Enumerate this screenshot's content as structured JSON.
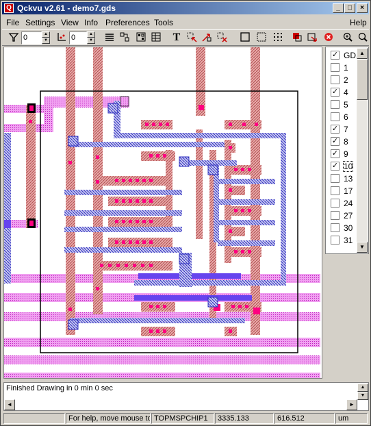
{
  "window": {
    "title": "Qckvu v2.61 - demo7.gds",
    "app_icon": "app-icon",
    "controls": [
      "_",
      "□",
      "×"
    ]
  },
  "menu": {
    "items": [
      "File",
      "Settings",
      "View",
      "Info",
      "Preferences",
      "Tools"
    ],
    "help": "Help"
  },
  "toolbar": {
    "filter_value": "0",
    "level_value": "0"
  },
  "layers": [
    {
      "label": "GDS",
      "checked": true
    },
    {
      "label": "1",
      "checked": false
    },
    {
      "label": "2",
      "checked": false
    },
    {
      "label": "4",
      "checked": true
    },
    {
      "label": "5",
      "checked": false
    },
    {
      "label": "6",
      "checked": false
    },
    {
      "label": "7",
      "checked": true
    },
    {
      "label": "8",
      "checked": true
    },
    {
      "label": "9",
      "checked": true
    },
    {
      "label": "10",
      "checked": true
    },
    {
      "label": "13",
      "checked": false
    },
    {
      "label": "17",
      "checked": false
    },
    {
      "label": "24",
      "checked": false
    },
    {
      "label": "27",
      "checked": false
    },
    {
      "label": "30",
      "checked": false
    },
    {
      "label": "31",
      "checked": false
    }
  ],
  "message": "Finished Drawing in 0 min 0 sec",
  "status": {
    "help_text": "For help, move mouse to",
    "cell": "TOPMSPCHIP1",
    "x": "3335.133",
    "y": "616.512",
    "unit": "um"
  },
  "colors": {
    "metal_pink": "#ff00cc",
    "poly_brown": "#cc6666",
    "metal_blue": "#3333cc",
    "stripe_magenta": "#cc33cc"
  }
}
